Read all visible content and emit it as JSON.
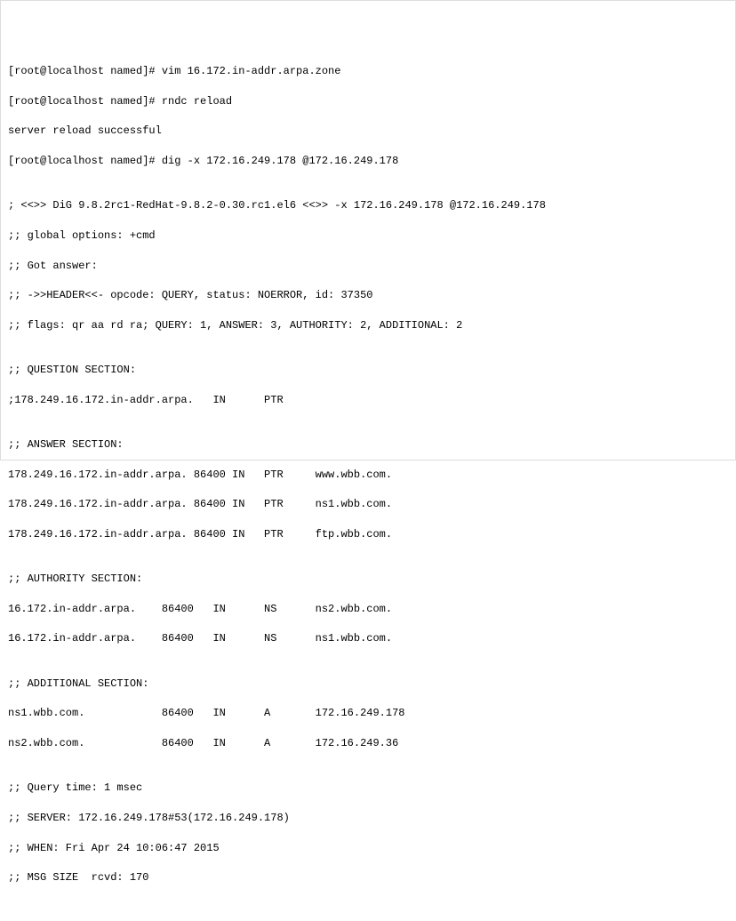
{
  "lines": {
    "l1": "[root@localhost named]# vim 16.172.in-addr.arpa.zone",
    "l2": "[root@localhost named]# rndc reload",
    "l3": "server reload successful",
    "l4": "[root@localhost named]# dig -x 172.16.249.178 @172.16.249.178",
    "l5": "",
    "l6": "; <<>> DiG 9.8.2rc1-RedHat-9.8.2-0.30.rc1.el6 <<>> -x 172.16.249.178 @172.16.249.178",
    "l7": ";; global options: +cmd",
    "l8": ";; Got answer:",
    "l9": ";; ->>HEADER<<- opcode: QUERY, status: NOERROR, id: 37350",
    "l10": ";; flags: qr aa rd ra; QUERY: 1, ANSWER: 3, AUTHORITY: 2, ADDITIONAL: 2",
    "l11": "",
    "l12": ";; QUESTION SECTION:",
    "l13": ";178.249.16.172.in-addr.arpa.   IN      PTR",
    "l14": "",
    "l15": ";; ANSWER SECTION:",
    "l16": "178.249.16.172.in-addr.arpa. 86400 IN   PTR     www.wbb.com.",
    "l17": "178.249.16.172.in-addr.arpa. 86400 IN   PTR     ns1.wbb.com.",
    "l18": "178.249.16.172.in-addr.arpa. 86400 IN   PTR     ftp.wbb.com.",
    "l19": "",
    "l20": ";; AUTHORITY SECTION:",
    "l21": "16.172.in-addr.arpa.    86400   IN      NS      ns2.wbb.com.",
    "l22": "16.172.in-addr.arpa.    86400   IN      NS      ns1.wbb.com.",
    "l23": "",
    "l24": ";; ADDITIONAL SECTION:",
    "l25": "ns1.wbb.com.            86400   IN      A       172.16.249.178",
    "l26": "ns2.wbb.com.            86400   IN      A       172.16.249.36",
    "l27": "",
    "l28": ";; Query time: 1 msec",
    "l29": ";; SERVER: 172.16.249.178#53(172.16.249.178)",
    "l30": ";; WHEN: Fri Apr 24 10:06:47 2015",
    "l31": ";; MSG SIZE  rcvd: 170"
  }
}
